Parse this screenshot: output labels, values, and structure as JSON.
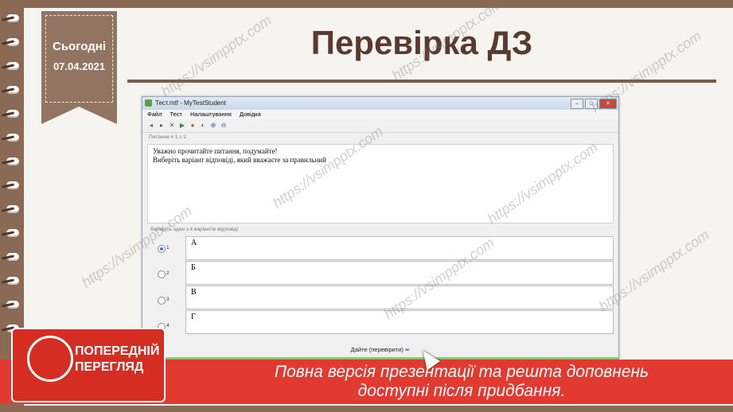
{
  "slide": {
    "today_label": "Сьогодні",
    "date": "07.04.2021",
    "title": "Перевірка ДЗ"
  },
  "window": {
    "title": "Тест.mtf - MyTestStudent",
    "menu": [
      "Файл",
      "Тест",
      "Налаштування",
      "Довідка"
    ],
    "question_panel_label": "Питання # 1 з 1:",
    "question_text": [
      "Уважно прочитайте питання, подумайте!",
      "Виберіть варіант відповіді, який вважаєте за правильний"
    ],
    "variants_label": "Виберіть один з 4 варіантів відповіді:",
    "answers": [
      {
        "num": "1",
        "text": "А",
        "selected": true
      },
      {
        "num": "2",
        "text": "Б",
        "selected": false
      },
      {
        "num": "3",
        "text": "В",
        "selected": false
      },
      {
        "num": "4",
        "text": "Г",
        "selected": false
      }
    ],
    "answer_button": "Дайте (перевірити)"
  },
  "banner": {
    "badge_text": [
      "ПОПЕРЕДНІЙ",
      "ПЕРЕГЛЯД"
    ],
    "message_line1": "Повна версія презентації та решта доповнень",
    "message_line2": "доступні після придбання."
  },
  "watermark": "https://vsimpptx.com",
  "colors": {
    "brown_title": "#5a3a2e",
    "ribbon": "#927462",
    "banner_red": "#e23a30"
  }
}
